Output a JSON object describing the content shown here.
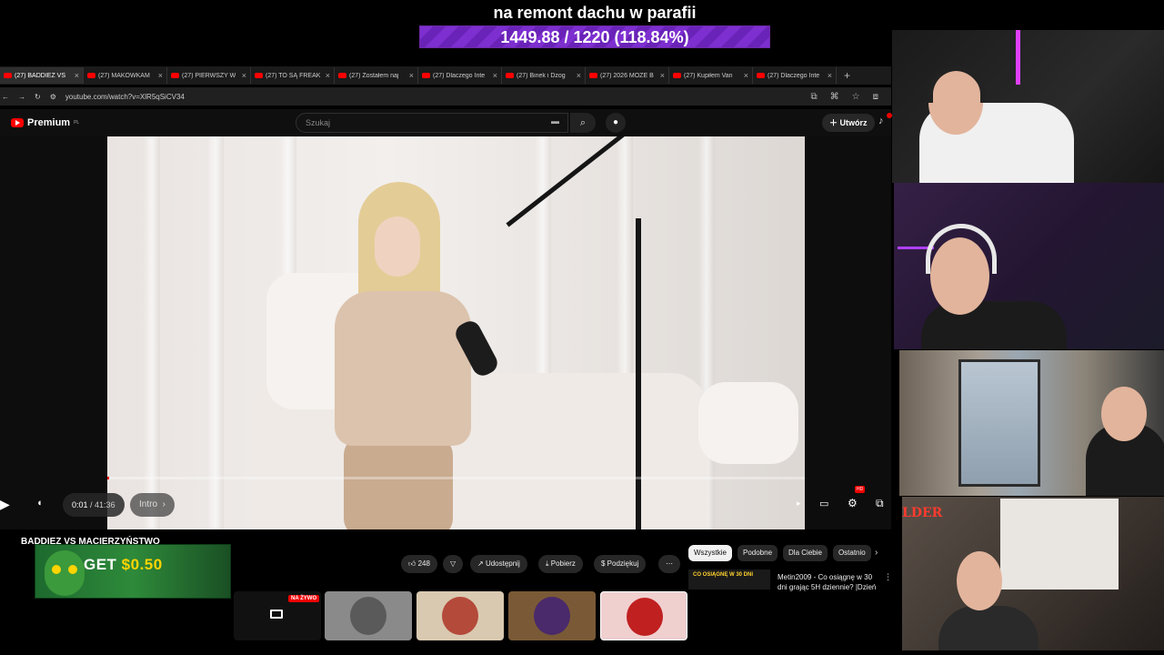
{
  "goal": {
    "title": "na remont dachu w parafii",
    "progress_text": "1449.88 / 1220 (118.84%)",
    "percent": 118.84,
    "bar_color": "#7d2fd0"
  },
  "browser": {
    "tabs": [
      {
        "label": "(27) BADDIEZ VS",
        "active": true
      },
      {
        "label": "(27) MAKOWKAM"
      },
      {
        "label": "(27) PIERWSZY W"
      },
      {
        "label": "(27) TO SĄ FREAK"
      },
      {
        "label": "(27) Zostałem naj"
      },
      {
        "label": "(27) Dlaczego Inte"
      },
      {
        "label": "(27) Binek i Dzog"
      },
      {
        "label": "(27) 2026 MOŻE B"
      },
      {
        "label": "(27) Kupiłem Van"
      },
      {
        "label": "(27) Dlaczego Inte"
      }
    ],
    "url": "youtube.com/watch?v=XlR5qSiCV34"
  },
  "youtube": {
    "logo": "Premium",
    "logo_region": "PL",
    "search_placeholder": "Szukaj",
    "create_label": "Utwórz",
    "accent": "#ff0000"
  },
  "player": {
    "time": "0:01",
    "duration": "41:36",
    "chapter": "Intro",
    "progress_fraction": 0.0004,
    "hd_badge": "HD"
  },
  "video": {
    "title": "BADDIEZ VS MACIERZYŃSTWO",
    "likes": "248",
    "share": "Udostępnij",
    "download": "Pobierz",
    "thanks": "Podziękuj"
  },
  "sidebar": {
    "chips": [
      "Wszystkie",
      "Podobne",
      "Dla Ciebie",
      "Ostatnio"
    ],
    "rec_thumb_text": "CO OSIĄGNĘ W 30 DNI",
    "rec_title": "Metin2009 - Co osiągnę w 30 dni grając 5H dziennie? |Dzień"
  },
  "promo": {
    "text_a": "GET ",
    "text_b": "$0.50"
  },
  "taskbar": {
    "live_badge": "NA ŻYWO"
  },
  "cam4_sign": "LDER"
}
